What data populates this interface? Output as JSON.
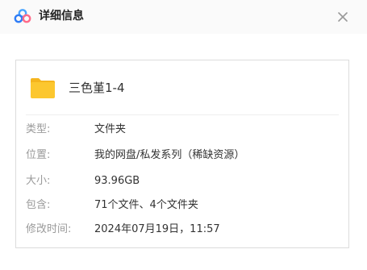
{
  "dialog": {
    "title": "详细信息"
  },
  "item": {
    "name": "三色堇1-4",
    "icon": "folder-icon"
  },
  "details": [
    {
      "label": "类型:",
      "value": "文件夹"
    },
    {
      "label": "位置:",
      "value": "我的网盘/私发系列（稀缺资源）"
    },
    {
      "label": "大小:",
      "value": "93.96GB"
    },
    {
      "label": "包含:",
      "value": "71个文件、4个文件夹"
    },
    {
      "label": "修改时间:",
      "value": "2024年07月19日，11:57"
    }
  ],
  "colors": {
    "folder": "#fcc72f",
    "title_bar": "#fafafa",
    "label": "#9a9a9a",
    "value": "#333333"
  }
}
